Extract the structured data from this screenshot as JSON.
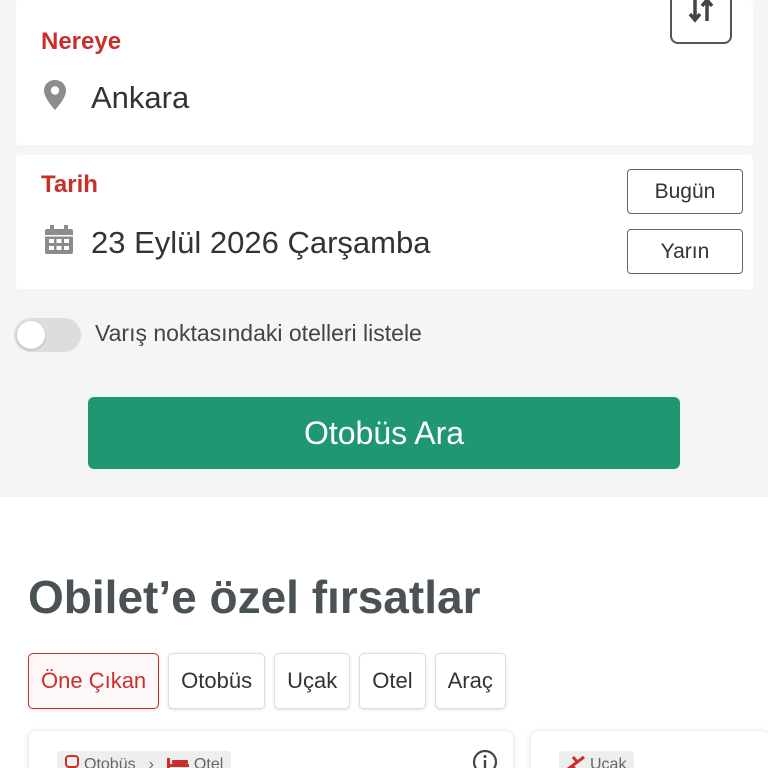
{
  "destination": {
    "label": "Nereye",
    "value": "Ankara",
    "icon": "location-pin-icon"
  },
  "date": {
    "label": "Tarih",
    "value": "23 Eylül 2026 Çarşamba",
    "icon": "calendar-icon",
    "today_label": "Bugün",
    "tomorrow_label": "Yarın"
  },
  "swap": {
    "icon": "swap-arrows-icon"
  },
  "hotels_toggle": {
    "label": "Varış noktasındaki otelleri listele",
    "checked": false
  },
  "search_button": {
    "label": "Otobüs Ara"
  },
  "deals": {
    "title": "Obilet’e özel fırsatlar",
    "tabs": [
      "Öne Çıkan",
      "Otobüs",
      "Uçak",
      "Otel",
      "Araç"
    ],
    "active_tab": "Öne Çıkan",
    "cards": [
      {
        "tag_from": "Otobüs",
        "tag_to": "Otel"
      },
      {
        "tag_from": "Uçak"
      }
    ]
  },
  "colors": {
    "accent_red": "#c9302c",
    "primary_green": "#1f9772",
    "background": "#f5f5f5"
  }
}
